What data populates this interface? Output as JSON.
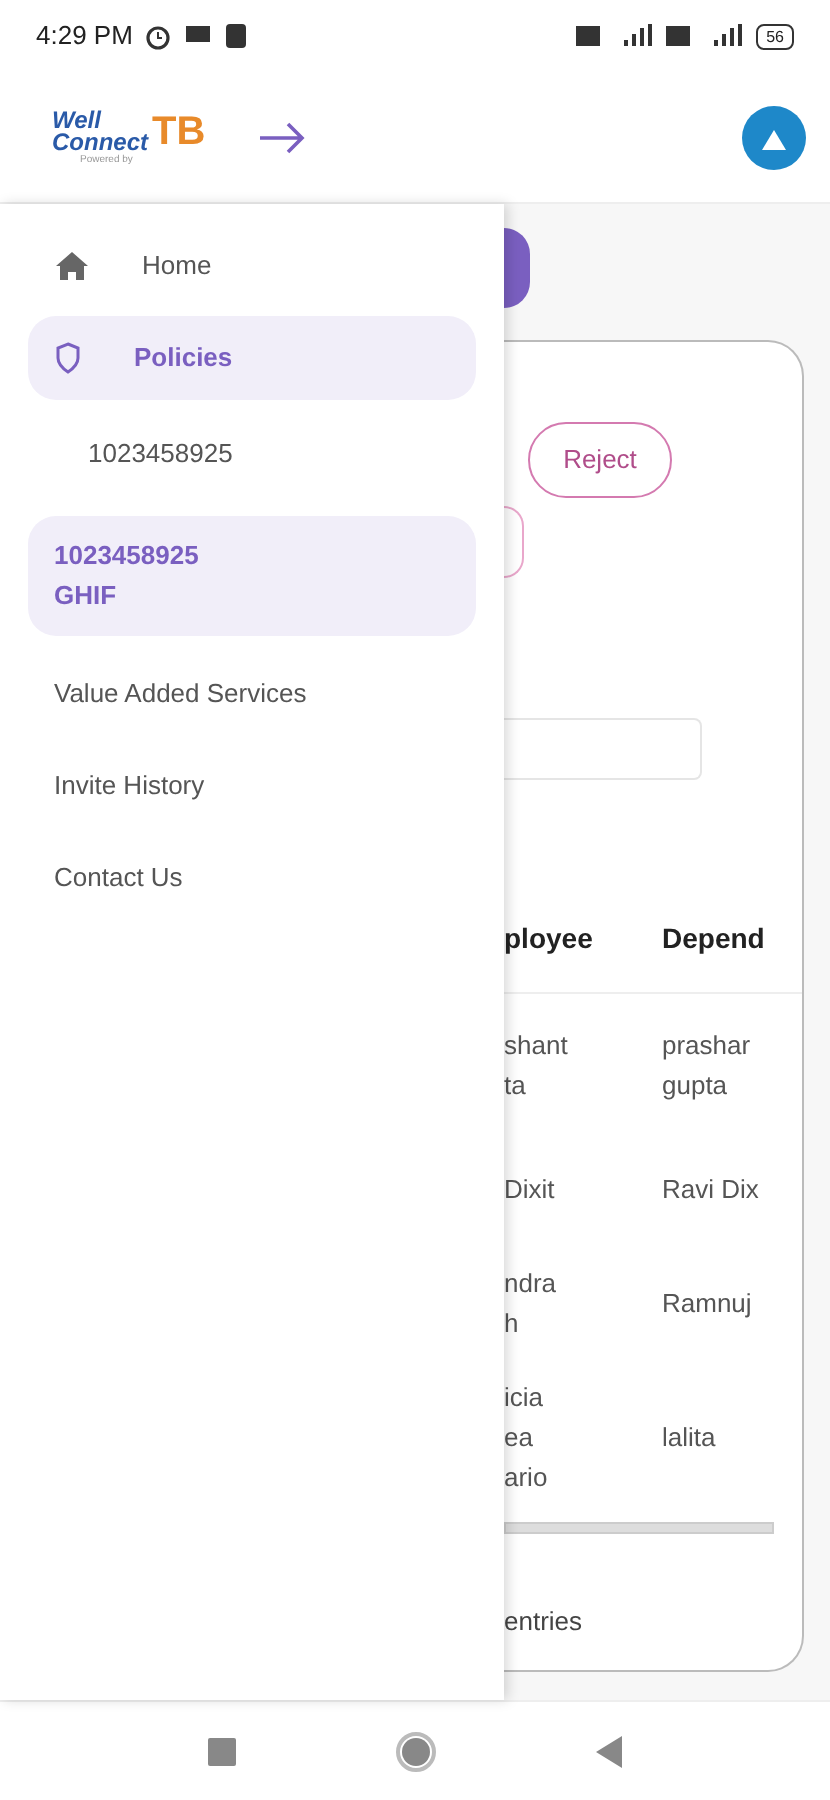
{
  "status_bar": {
    "time": "4:29 PM",
    "battery": "56"
  },
  "header": {
    "logo": {
      "line1": "Well",
      "line2": "Connect",
      "mark": "TB",
      "tagline": "Powered by"
    }
  },
  "drawer": {
    "items": [
      {
        "kind": "home",
        "label": "Home",
        "selected": false
      },
      {
        "kind": "section",
        "label": "Policies",
        "selected": true
      },
      {
        "kind": "sub",
        "label": "1023458925",
        "selected": false
      },
      {
        "kind": "sub",
        "label": "1023458925\nGHIF",
        "selected": true
      },
      {
        "kind": "plain",
        "label": "Value Added Services",
        "selected": false
      },
      {
        "kind": "plain",
        "label": "Invite History",
        "selected": false
      },
      {
        "kind": "plain",
        "label": "Contact Us",
        "selected": false
      }
    ]
  },
  "background_page": {
    "reject_button": "Reject",
    "table": {
      "columns": [
        "ployee",
        "Depend"
      ],
      "rows": [
        [
          "shant\nta",
          "prashar\ngupta"
        ],
        [
          "Dixit",
          "Ravi Dix"
        ],
        [
          "ndra\nh",
          "Ramnuj"
        ],
        [
          "icia\nea\nario",
          "lalita"
        ]
      ]
    },
    "footer_text": "entries"
  }
}
